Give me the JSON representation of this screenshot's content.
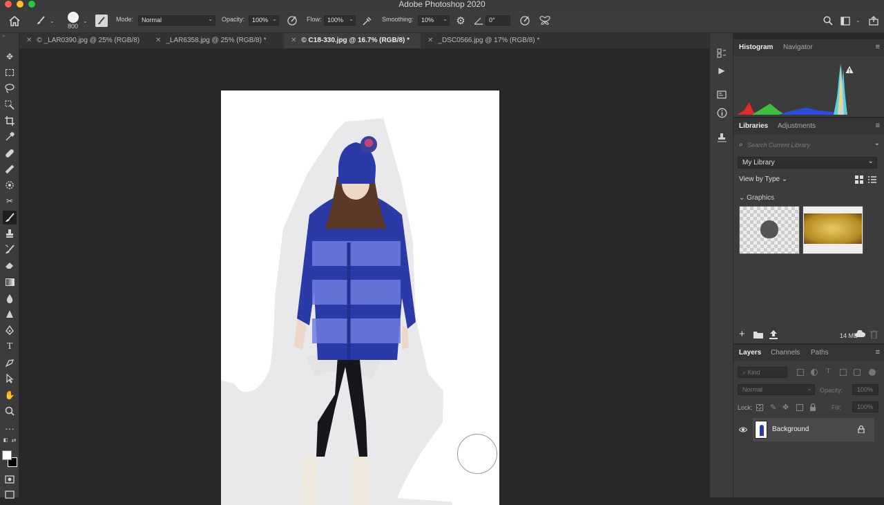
{
  "window": {
    "title": "Adobe Photoshop 2020"
  },
  "options_bar": {
    "brush_size": "800",
    "mode_label": "Mode:",
    "mode_value": "Normal",
    "opacity_label": "Opacity:",
    "opacity_value": "100%",
    "flow_label": "Flow:",
    "flow_value": "100%",
    "smoothing_label": "Smoothing:",
    "smoothing_value": "10%",
    "angle_value": "0°"
  },
  "tabs": [
    {
      "label": "© _LAR0390.jpg @ 25% (RGB/8)"
    },
    {
      "label": "_LAR6358.jpg @ 25% (RGB/8) *"
    },
    {
      "label": "© C18-330.jpg @ 16.7% (RGB/8) *"
    },
    {
      "label": "_DSC0566.jpg @ 17% (RGB/8) *"
    }
  ],
  "histogram_panel": {
    "tab1": "Histogram",
    "tab2": "Navigator"
  },
  "libraries_panel": {
    "tab1": "Libraries",
    "tab2": "Adjustments",
    "search_placeholder": "Search Current Library",
    "library_value": "My Library",
    "view_by": "View by Type",
    "section": "Graphics",
    "size": "14 MB"
  },
  "layers_panel": {
    "tab1": "Layers",
    "tab2": "Channels",
    "tab3": "Paths",
    "filter_placeholder": "Kind",
    "blend_mode": "Normal",
    "opacity_label": "Opacity:",
    "opacity_value": "100%",
    "lock_label": "Lock:",
    "fill_label": "Fill:",
    "fill_value": "100%",
    "layers": [
      {
        "name": "Background"
      }
    ]
  },
  "colors": {
    "panel_bg": "#3c3c3c",
    "canvas_bg": "#282828",
    "sweater_blue": "#2c3aa8",
    "accent_highlight": "#4a4a4a"
  }
}
